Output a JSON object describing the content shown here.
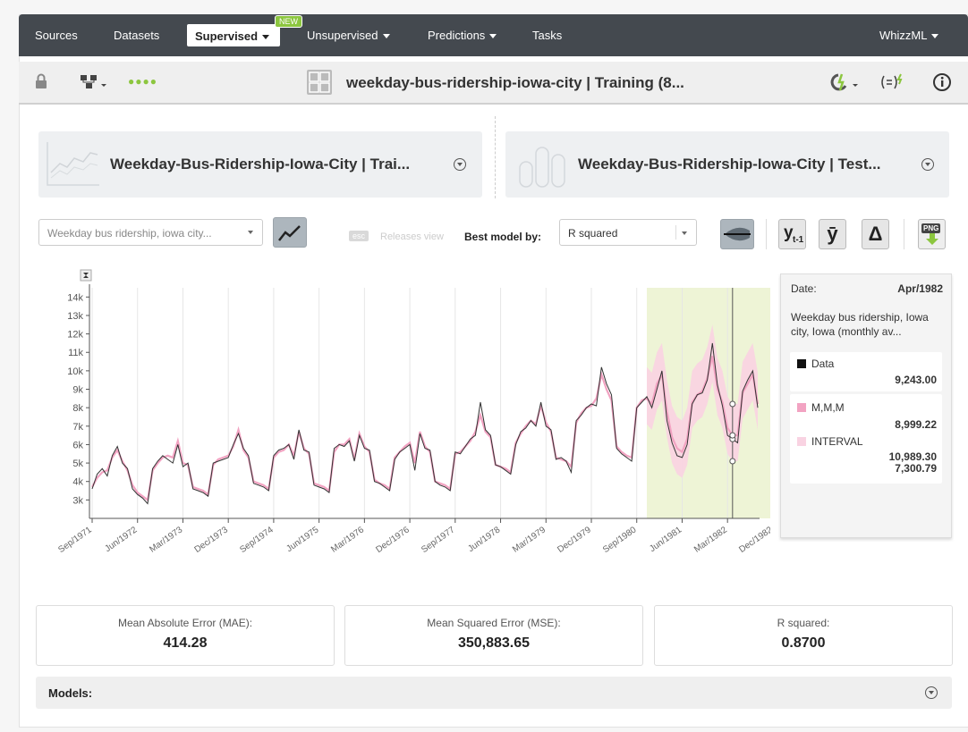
{
  "nav": {
    "items": [
      "Sources",
      "Datasets",
      "Unsupervised",
      "Predictions",
      "Tasks"
    ],
    "active": "Supervised",
    "badge": "NEW",
    "right": "WhizzML"
  },
  "toolbar": {
    "title": "weekday-bus-ridership-iowa-city | Training (8...",
    "status_dots": "●●●●"
  },
  "sources": {
    "training": "Weekday-Bus-Ridership-Iowa-City | Trai...",
    "test": "Weekday-Bus-Ridership-Iowa-City | Test..."
  },
  "controls": {
    "field_select": "Weekday bus ridership, iowa city...",
    "esc_label": "esc",
    "releases_view": "Releases view",
    "best_model_label": "Best model by:",
    "best_model_value": "R squared",
    "btn_lag": "y",
    "btn_lag_sub": "t-1",
    "btn_mean": "ȳ",
    "btn_delta": "Δ",
    "btn_png": "PNG"
  },
  "chart_data": {
    "type": "line",
    "y_ticks": [
      "3k",
      "4k",
      "5k",
      "6k",
      "7k",
      "8k",
      "9k",
      "10k",
      "11k",
      "12k",
      "13k",
      "14k"
    ],
    "x_ticks": [
      "Sep/1971",
      "Jun/1972",
      "Mar/1973",
      "Dec/1973",
      "Sep/1974",
      "Jun/1975",
      "Mar/1976",
      "Dec/1976",
      "Sep/1977",
      "Jun/1978",
      "Mar/1979",
      "Dec/1979",
      "Sep/1980",
      "Jun/1981",
      "Mar/1982",
      "Dec/1982"
    ],
    "ylim": [
      2000,
      14500
    ],
    "x_start": "Sep/1971",
    "interval_months": 1,
    "test_region_start": "Nov/1980",
    "test_region_end": "Dec/1982",
    "cursor_date": "Apr/1982",
    "series": [
      {
        "name": "Data",
        "color": "#333333",
        "values": [
          3600,
          4400,
          4700,
          4300,
          5400,
          5900,
          5000,
          4700,
          3600,
          3300,
          3100,
          2800,
          4700,
          5100,
          5400,
          5200,
          5000,
          6000,
          4800,
          5000,
          3600,
          3500,
          3400,
          3200,
          5000,
          5100,
          5200,
          5300,
          6000,
          6600,
          5800,
          5400,
          3900,
          3800,
          3700,
          3500,
          5400,
          5700,
          5800,
          6000,
          5200,
          6800,
          5700,
          5600,
          3800,
          3700,
          3600,
          3400,
          5800,
          6000,
          5900,
          6200,
          5100,
          6500,
          5800,
          5700,
          4000,
          3900,
          3700,
          3500,
          5200,
          5600,
          5800,
          6000,
          4600,
          6600,
          5800,
          5700,
          4000,
          3800,
          3700,
          3500,
          5600,
          5500,
          5900,
          6300,
          6500,
          8300,
          6800,
          6500,
          4900,
          4800,
          4600,
          4400,
          6000,
          6700,
          6900,
          7300,
          7000,
          8300,
          7000,
          6800,
          5200,
          5300,
          5100,
          4500,
          7300,
          7600,
          8000,
          8200,
          8100,
          10200,
          9300,
          8700,
          5800,
          5500,
          5300,
          5100,
          8000,
          8300,
          8600,
          8000,
          9000,
          10000,
          7300,
          6100,
          5400,
          5300,
          6000,
          8200,
          8700,
          8800,
          9500,
          11500,
          9243,
          8100,
          6500,
          6300,
          6100,
          8900,
          9500,
          10000,
          8000
        ]
      },
      {
        "name": "M,M,M",
        "color": "#f2a3c2",
        "values": [
          3700,
          4200,
          4500,
          4600,
          5300,
          5700,
          5100,
          4600,
          3800,
          3400,
          3200,
          3000,
          4600,
          5000,
          5300,
          5400,
          5300,
          6200,
          5000,
          4900,
          3700,
          3600,
          3500,
          3300,
          4900,
          5200,
          5300,
          5400,
          5900,
          6800,
          5700,
          5300,
          4000,
          3900,
          3800,
          3600,
          5300,
          5600,
          5700,
          6000,
          5400,
          6700,
          5800,
          5500,
          3900,
          3800,
          3700,
          3500,
          5600,
          6000,
          6000,
          6300,
          5200,
          6600,
          5900,
          5600,
          4100,
          3900,
          3800,
          3600,
          5300,
          5600,
          5900,
          6100,
          5000,
          6700,
          5900,
          5600,
          4000,
          3900,
          3800,
          3600,
          5500,
          5600,
          5900,
          6200,
          6700,
          7600,
          6700,
          6400,
          4900,
          4800,
          4700,
          4500,
          6100,
          6600,
          7000,
          7300,
          7100,
          8100,
          7200,
          6700,
          5300,
          5200,
          5100,
          4800,
          7200,
          7700,
          8000,
          8100,
          8500,
          9800,
          9000,
          8400,
          5900,
          5600,
          5400,
          5300,
          8000,
          8400,
          8500,
          8200,
          9300,
          9800,
          7800,
          6400,
          5800,
          5600,
          6300,
          8300,
          8700,
          8900,
          9600,
          10800,
          8999,
          8300,
          6900,
          6500,
          6500,
          8800,
          9300,
          9800,
          8200
        ]
      },
      {
        "name": "INTERVAL",
        "color": "#f9d3e2"
      }
    ]
  },
  "tooltip": {
    "date_label": "Date:",
    "date_value": "Apr/1982",
    "field": "Weekday bus ridership, Iowa city, Iowa (monthly av...",
    "data_label": "Data",
    "data_value": "9,243.00",
    "model_label": "M,M,M",
    "model_value": "8,999.22",
    "interval_label": "INTERVAL",
    "interval_high": "10,989.30",
    "interval_low": "7,300.79"
  },
  "metrics": [
    {
      "label": "Mean Absolute Error (MAE):",
      "value": "414.28"
    },
    {
      "label": "Mean Squared Error (MSE):",
      "value": "350,883.65"
    },
    {
      "label": "R squared:",
      "value": "0.8700"
    }
  ],
  "models": {
    "label": "Models:"
  }
}
